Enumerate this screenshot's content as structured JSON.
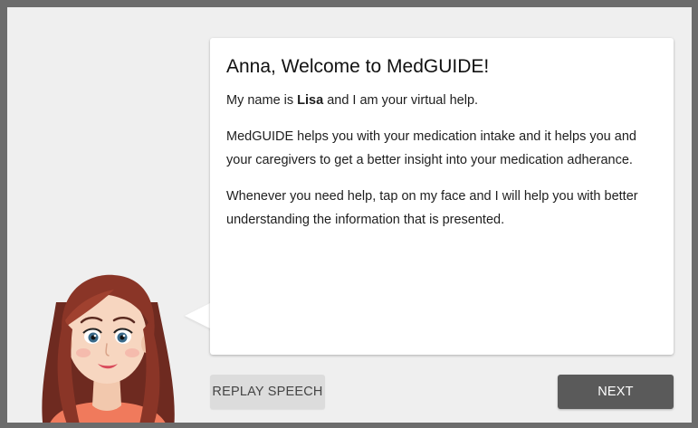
{
  "welcome": {
    "title": "Anna, Welcome to MedGUIDE!",
    "intro_prefix": "My name is ",
    "assistant_name": "Lisa",
    "intro_suffix": " and I am your virtual help.",
    "paragraph_2": "MedGUIDE helps you with your medication intake and it helps you and your caregivers to get a better insight into your medication adherance.",
    "paragraph_3": "Whenever you need help, tap on my face and I will help you with better understanding the information that is presented."
  },
  "buttons": {
    "replay_label": "REPLAY SPEECH",
    "next_label": "NEXT"
  },
  "icons": {
    "avatar": "virtual-assistant-avatar"
  },
  "colors": {
    "frame": "#6c6c6c",
    "background": "#efefef",
    "card": "#ffffff",
    "replay_button": "#dcdcdc",
    "next_button": "#5a5a5a",
    "hair": "#7a2f24",
    "shirt": "#f07a5c"
  }
}
